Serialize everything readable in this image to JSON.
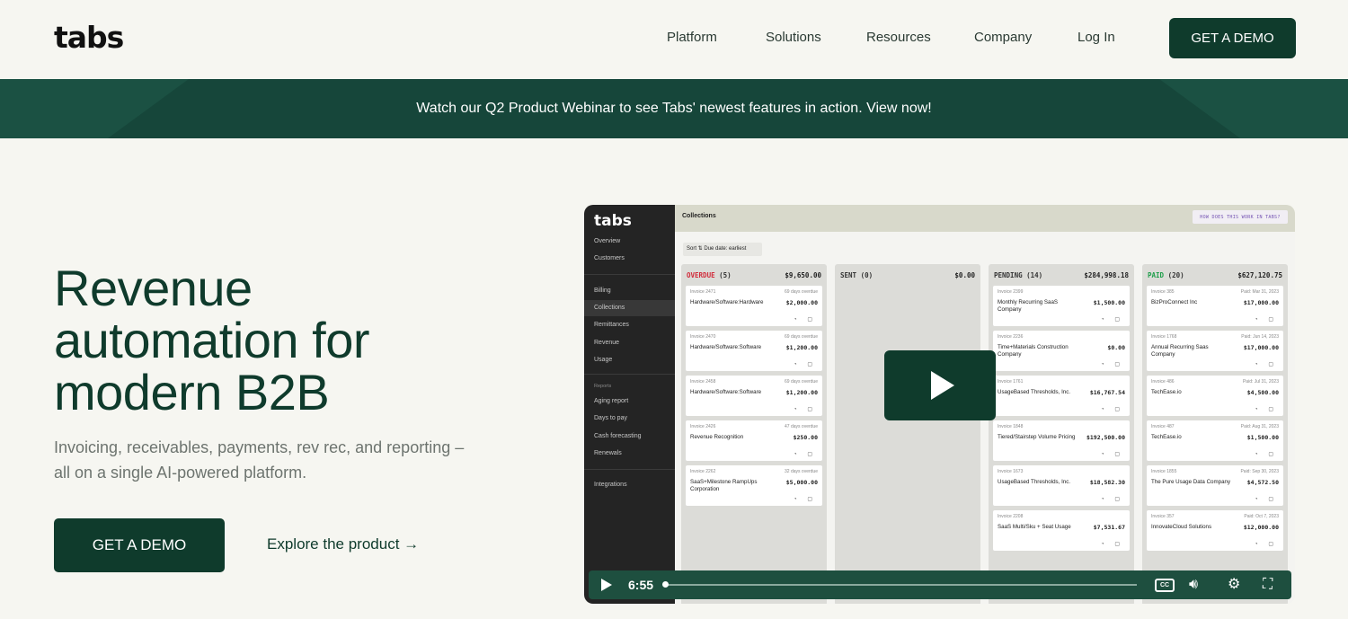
{
  "nav": {
    "logo": "tabs",
    "links": [
      "Platform",
      "Solutions",
      "Resources",
      "Company",
      "Log In"
    ],
    "cta": "GET A DEMO"
  },
  "banner": {
    "text": "Watch our Q2 Product Webinar to see Tabs' newest features in action. View now!"
  },
  "hero": {
    "title": "Revenue automation for modern B2B",
    "subtitle": "Invoicing, receivables, payments, rev rec, and reporting – all on a single AI-powered platform.",
    "cta": "GET A DEMO",
    "link": "Explore the product →"
  },
  "video": {
    "app_logo": "tabs",
    "sidebar": {
      "items_top": [
        "Overview",
        "Customers"
      ],
      "items_main": [
        "Billing",
        "Collections",
        "Remittances",
        "Revenue",
        "Usage"
      ],
      "reports_label": "Reports",
      "items_reports": [
        "Aging report",
        "Days to pay",
        "Cash forecasting",
        "Renewals"
      ],
      "integrations": "Integrations"
    },
    "page_title": "Collections",
    "how_button": "HOW DOES THIS WORK IN TABS?",
    "sort_label": "Sort ⇅  Due date: earliest",
    "columns": [
      {
        "label": "OVERDUE",
        "count": "(5)",
        "total": "$9,650.00",
        "color": "#d12c3b",
        "cards": [
          {
            "inv": "Invoice 2471",
            "meta": "69 days overdue",
            "name": "Hardware/Software:Hardware",
            "amount": "$2,000.00"
          },
          {
            "inv": "Invoice 2470",
            "meta": "69 days overdue",
            "name": "Hardware/Software:Software",
            "amount": "$1,200.00"
          },
          {
            "inv": "Invoice 2458",
            "meta": "69 days overdue",
            "name": "Hardware/Software:Software",
            "amount": "$1,200.00"
          },
          {
            "inv": "Invoice 2426",
            "meta": "47 days overdue",
            "name": "Revenue Recognition",
            "amount": "$250.00"
          },
          {
            "inv": "Invoice 2262",
            "meta": "32 days overdue",
            "name": "SaaS+Milestone RampUps Corporation",
            "amount": "$5,000.00"
          }
        ]
      },
      {
        "label": "SENT",
        "count": "(0)",
        "total": "$0.00",
        "color": "#333333",
        "cards": []
      },
      {
        "label": "PENDING",
        "count": "(14)",
        "total": "$284,998.18",
        "color": "#333333",
        "cards": [
          {
            "inv": "Invoice 2399",
            "meta": "",
            "name": "Monthly Recurring SaaS Company",
            "amount": "$1,500.00"
          },
          {
            "inv": "Invoice 2236",
            "meta": "",
            "name": "Time+Materials Construction Company",
            "amount": "$0.00"
          },
          {
            "inv": "Invoice 1761",
            "meta": "",
            "name": "UsageBased Thresholds, Inc.",
            "amount": "$16,767.54"
          },
          {
            "inv": "Invoice 1848",
            "meta": "",
            "name": "Tiered/Stairstep Volume Pricing",
            "amount": "$192,500.00"
          },
          {
            "inv": "Invoice 1673",
            "meta": "",
            "name": "UsageBased Thresholds, Inc.",
            "amount": "$18,582.30"
          },
          {
            "inv": "Invoice 2208",
            "meta": "",
            "name": "SaaS Multi/Sku + Seat Usage",
            "amount": "$7,531.67"
          }
        ]
      },
      {
        "label": "PAID",
        "count": "(20)",
        "total": "$627,120.75",
        "color": "#1e9e4a",
        "cards": [
          {
            "inv": "Invoice 385",
            "meta": "Paid: Mar 31, 2023",
            "name": "BizProConnect Inc",
            "amount": "$17,000.00"
          },
          {
            "inv": "Invoice 1768",
            "meta": "Paid: Jun 14, 2023",
            "name": "Annual Recurring Saas Company",
            "amount": "$17,000.00"
          },
          {
            "inv": "Invoice 486",
            "meta": "Paid: Jul 31, 2023",
            "name": "TechEase.io",
            "amount": "$4,500.00"
          },
          {
            "inv": "Invoice 487",
            "meta": "Paid: Aug 31, 2023",
            "name": "TechEase.io",
            "amount": "$1,500.00"
          },
          {
            "inv": "Invoice 1855",
            "meta": "Paid: Sep 30, 2023",
            "name": "The Pure Usage Data Company",
            "amount": "$4,572.50"
          },
          {
            "inv": "Invoice 357",
            "meta": "Paid: Oct 7, 2023",
            "name": "InnovateCloud Solutions",
            "amount": "$12,000.00"
          }
        ]
      }
    ],
    "controls": {
      "time": "6:55",
      "cc": "CC",
      "progress": 0.0
    }
  }
}
